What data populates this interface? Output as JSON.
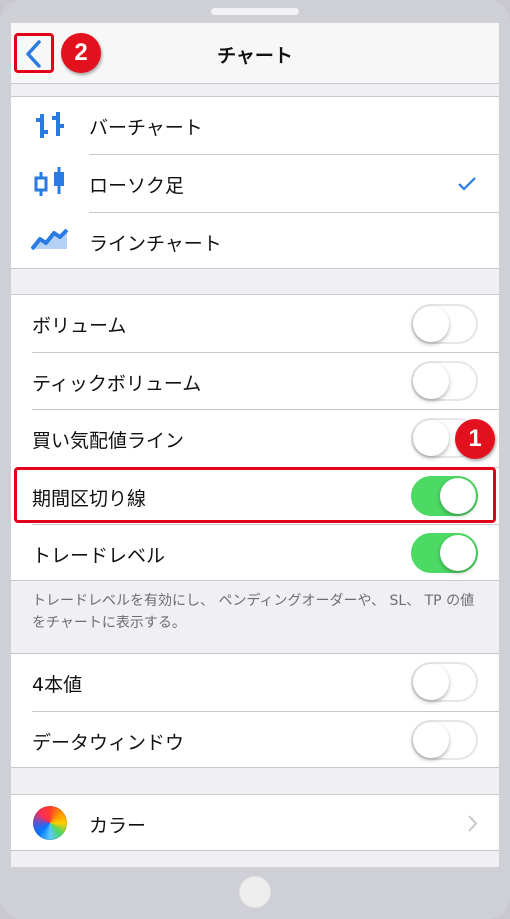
{
  "nav": {
    "title": "チャート"
  },
  "badges": {
    "back": "2",
    "toggle": "1"
  },
  "chart_types": {
    "items": [
      {
        "label": "バーチャート",
        "icon": "bar-chart-icon",
        "selected": false
      },
      {
        "label": "ローソク足",
        "icon": "candlestick-icon",
        "selected": true
      },
      {
        "label": "ラインチャート",
        "icon": "line-chart-icon",
        "selected": false
      }
    ]
  },
  "display_settings": {
    "items": [
      {
        "label": "ボリューム",
        "on": false
      },
      {
        "label": "ティックボリューム",
        "on": false
      },
      {
        "label": "買い気配値ライン",
        "on": false
      },
      {
        "label": "期間区切り線",
        "on": true
      },
      {
        "label": "トレードレベル",
        "on": true
      }
    ],
    "footnote": "トレードレベルを有効にし、 ペンディングオーダーや、 SL、 TP の値をチャートに表示する。"
  },
  "extra_settings": {
    "items": [
      {
        "label": "4本値",
        "on": false
      },
      {
        "label": "データウィンドウ",
        "on": false
      }
    ]
  },
  "color": {
    "label": "カラー"
  },
  "colors": {
    "accent": "#2a7ae4",
    "toggle_on": "#4cd964",
    "highlight": "#e2001a"
  }
}
